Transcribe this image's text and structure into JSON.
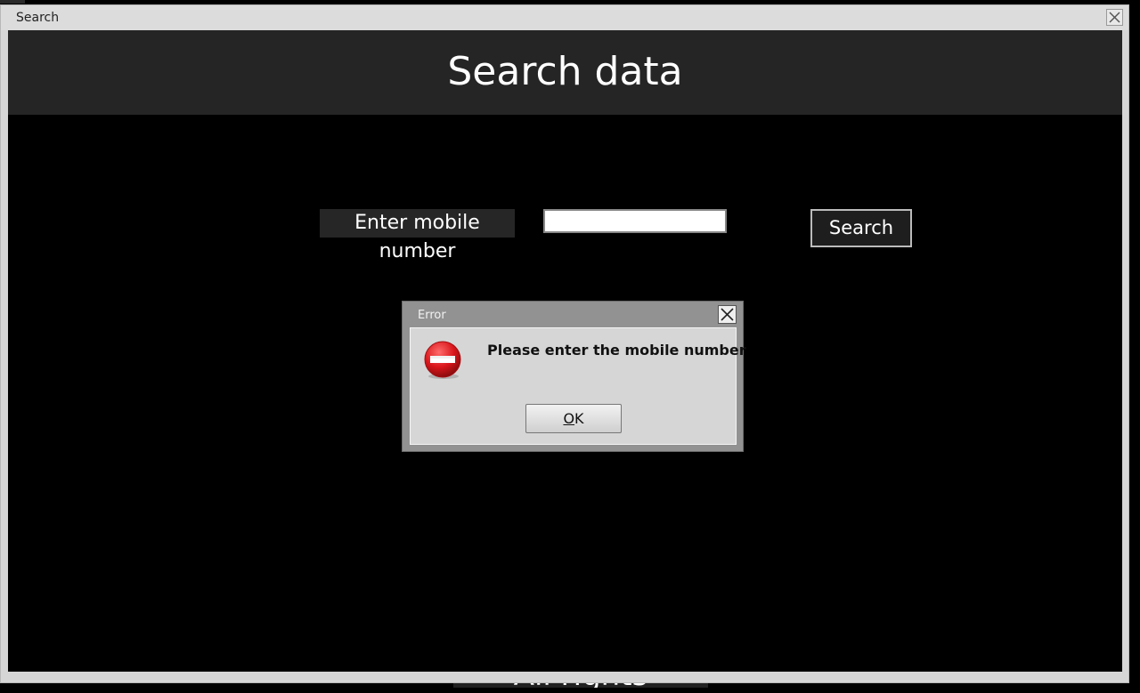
{
  "window": {
    "title": "Search",
    "close_icon": "close-icon"
  },
  "header": {
    "title": "Search data"
  },
  "form": {
    "mobile_label": "Enter mobile number",
    "mobile_value": "",
    "search_label": "Search"
  },
  "footer": {
    "text": "All rights reserved"
  },
  "dialog": {
    "title": "Error",
    "message": "Please enter the mobile number",
    "ok_mnemonic": "O",
    "ok_rest": "K",
    "icon": "error-stop-icon",
    "close_icon": "close-icon"
  },
  "colors": {
    "background": "#000000",
    "header_band": "#252525",
    "dialog_frame": "#929292",
    "dialog_body": "#d6d6d6",
    "error_red": "#d9161b"
  }
}
